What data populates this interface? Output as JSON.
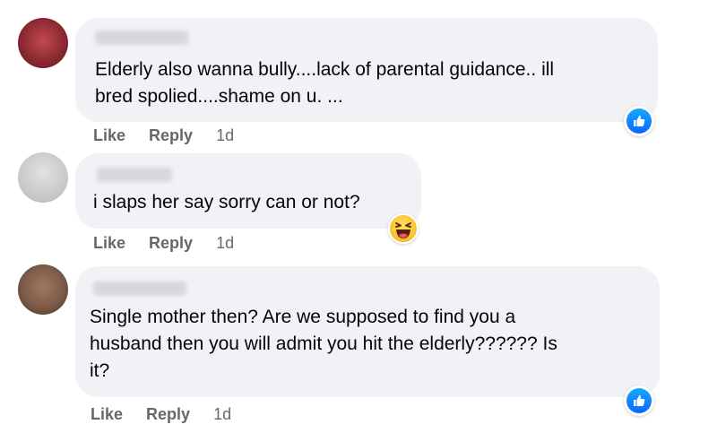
{
  "comments": [
    {
      "text": "Elderly also wanna bully....lack of parental guidance.. ill\nbred spolied....shame on u. ...",
      "like_label": "Like",
      "reply_label": "Reply",
      "time": "1d",
      "reaction": "like-icon",
      "avatar_color": "#9b2d36"
    },
    {
      "text": "i slaps her say sorry can or not?",
      "like_label": "Like",
      "reply_label": "Reply",
      "time": "1d",
      "reaction": "haha-icon",
      "avatar_color": "#c9c9cc"
    },
    {
      "text": "Single mother then? Are we supposed to find you a\nhusband then you will admit you hit the elderly?????? Is\nit?",
      "like_label": "Like",
      "reply_label": "Reply",
      "time": "1d",
      "reaction": "like-icon",
      "avatar_color": "#7a5a48"
    }
  ],
  "colors": {
    "bubble": "#f0f2f5",
    "text": "#050505",
    "meta": "#65676b",
    "like_blue": "#0866ff"
  }
}
